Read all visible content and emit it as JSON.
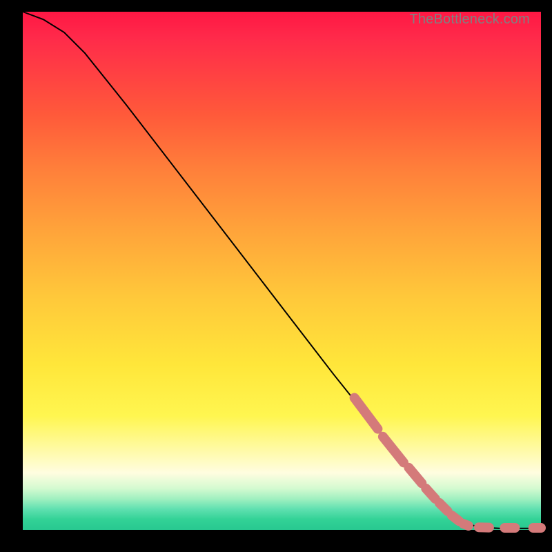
{
  "attribution": "TheBottleneck.com",
  "colors": {
    "dash": "#d47a7a",
    "curve": "#000000"
  },
  "chart_data": {
    "type": "line",
    "title": "",
    "xlabel": "",
    "ylabel": "",
    "xlim": [
      0,
      100
    ],
    "ylim": [
      0,
      100
    ],
    "grid": false,
    "series": [
      {
        "name": "curve",
        "style": "solid",
        "points": [
          {
            "x": 0,
            "y": 100
          },
          {
            "x": 4,
            "y": 98.5
          },
          {
            "x": 8,
            "y": 96
          },
          {
            "x": 12,
            "y": 92
          },
          {
            "x": 20,
            "y": 82
          },
          {
            "x": 30,
            "y": 69
          },
          {
            "x": 40,
            "y": 56
          },
          {
            "x": 50,
            "y": 43
          },
          {
            "x": 60,
            "y": 30
          },
          {
            "x": 70,
            "y": 17.5
          },
          {
            "x": 80,
            "y": 6
          },
          {
            "x": 85,
            "y": 1.5
          },
          {
            "x": 88,
            "y": 0.5
          },
          {
            "x": 92,
            "y": 0.3
          },
          {
            "x": 96,
            "y": 0.3
          },
          {
            "x": 100,
            "y": 0.3
          }
        ]
      },
      {
        "name": "highlighted-dashes",
        "style": "dashed-overlay",
        "segments": [
          {
            "x1": 64,
            "y1": 25.5,
            "x2": 68.5,
            "y2": 19.5
          },
          {
            "x1": 69.5,
            "y1": 18,
            "x2": 73.5,
            "y2": 13
          },
          {
            "x1": 74.5,
            "y1": 12,
            "x2": 77,
            "y2": 9
          },
          {
            "x1": 77.8,
            "y1": 8,
            "x2": 79.6,
            "y2": 6
          },
          {
            "x1": 80.4,
            "y1": 5.2,
            "x2": 82,
            "y2": 3.6
          },
          {
            "x1": 82.8,
            "y1": 2.8,
            "x2": 84.2,
            "y2": 1.7
          },
          {
            "x1": 85,
            "y1": 1.2,
            "x2": 86,
            "y2": 0.8
          },
          {
            "x1": 88,
            "y1": 0.5,
            "x2": 90,
            "y2": 0.45
          },
          {
            "x1": 93,
            "y1": 0.4,
            "x2": 95,
            "y2": 0.4
          },
          {
            "x1": 98.5,
            "y1": 0.4,
            "x2": 100,
            "y2": 0.4
          }
        ]
      }
    ]
  }
}
